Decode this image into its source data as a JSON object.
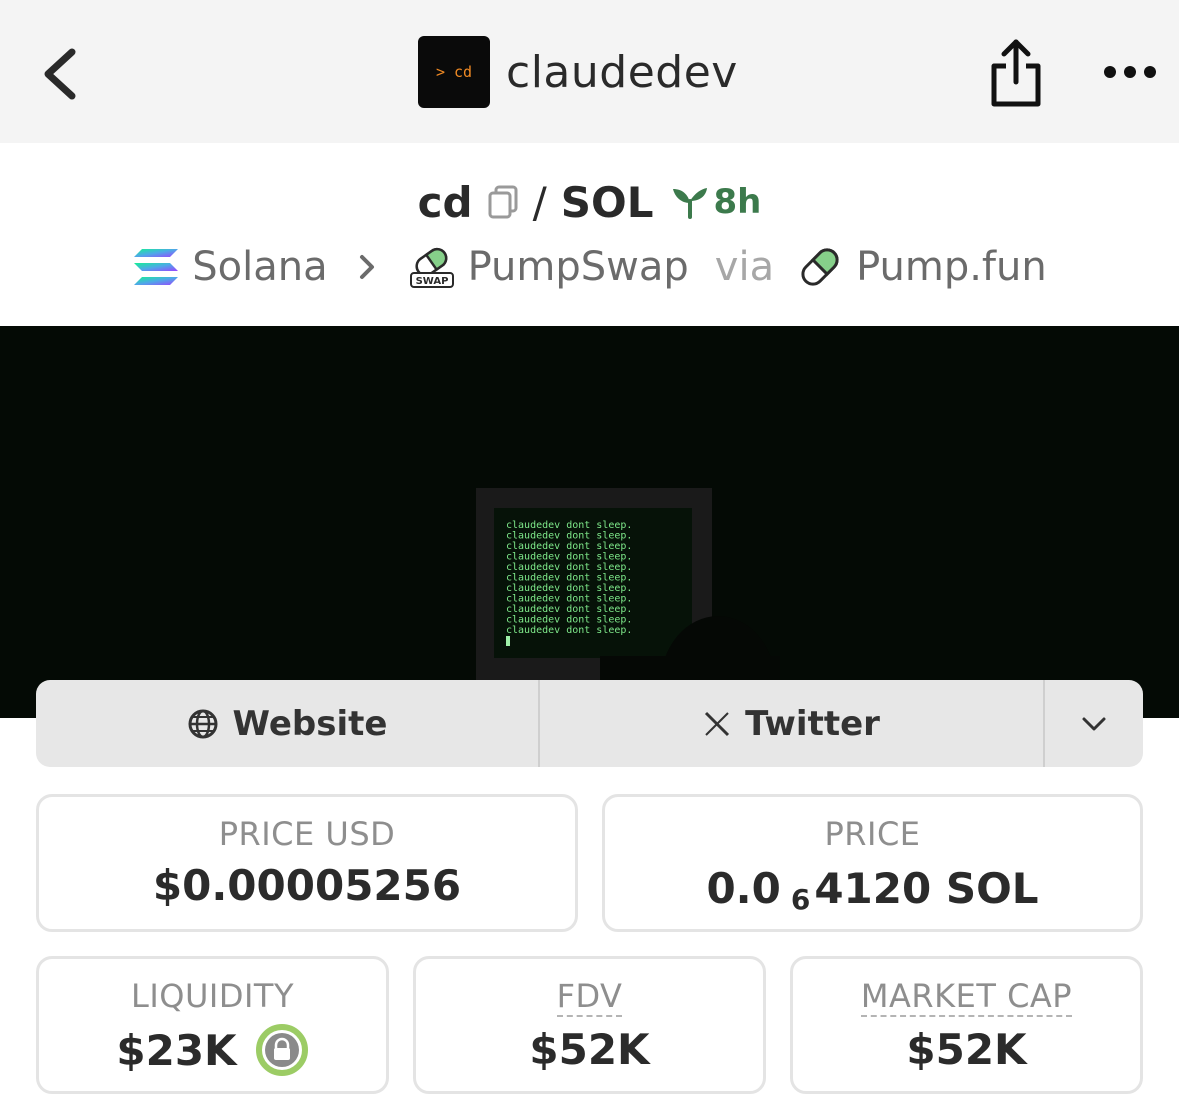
{
  "header": {
    "avatar_text": "> cd",
    "title": "claudedev"
  },
  "pair": {
    "base": "cd",
    "separator": "/",
    "quote": "SOL",
    "age": "8h"
  },
  "route": {
    "chain": "Solana",
    "dex": "PumpSwap",
    "dex_badge": "SWAP",
    "via": "via",
    "launchpad": "Pump.fun"
  },
  "hero": {
    "screen_lines": [
      "claudedev dont sleep.",
      "claudedev dont sleep.",
      "claudedev dont sleep.",
      "claudedev dont sleep.",
      "claudedev dont sleep.",
      "claudedev dont sleep.",
      "claudedev dont sleep.",
      "claudedev dont sleep.",
      "claudedev dont sleep.",
      "claudedev dont sleep.",
      "claudedev dont sleep."
    ]
  },
  "links": {
    "website": "Website",
    "twitter": "Twitter"
  },
  "stats": {
    "price_usd_label": "PRICE USD",
    "price_usd_value": "$0.00005256",
    "price_label": "PRICE",
    "price_prefix": "0.0",
    "price_zero_count": "6",
    "price_rest": "4120 SOL",
    "liquidity_label": "LIQUIDITY",
    "liquidity_value": "$23K",
    "fdv_label": "FDV",
    "fdv_value": "$52K",
    "market_cap_label": "MARKET CAP",
    "market_cap_value": "$52K"
  },
  "colors": {
    "accent_green": "#3c7a4c",
    "lock_ring": "#9ccc65",
    "avatar_text": "#f08a24"
  }
}
